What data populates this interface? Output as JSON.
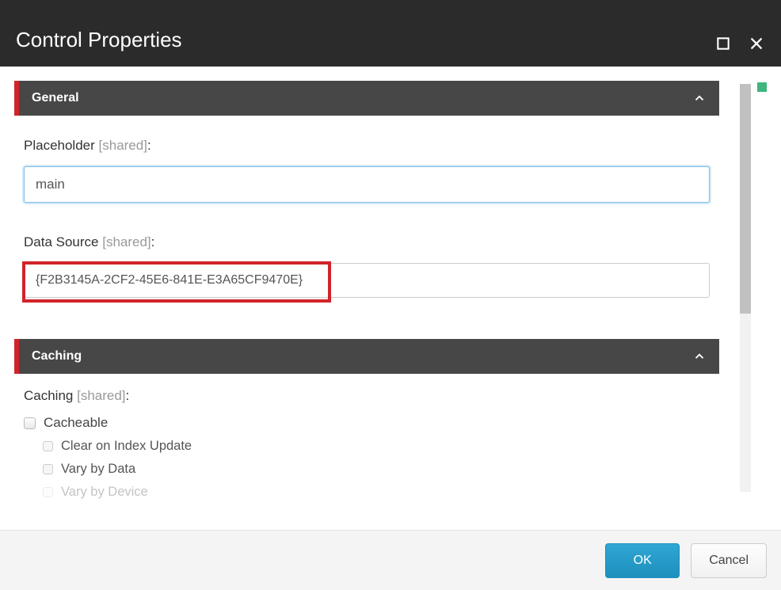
{
  "header": {
    "title": "Control Properties"
  },
  "sections": {
    "general": {
      "title": "General",
      "placeholder_label": "Placeholder",
      "shared_tag": "[shared]",
      "placeholder_value": "main",
      "datasource_label": "Data Source",
      "datasource_value": "{F2B3145A-2CF2-45E6-841E-E3A65CF9470E}"
    },
    "caching": {
      "title": "Caching",
      "caching_label": "Caching",
      "shared_tag": "[shared]",
      "options": {
        "cacheable": "Cacheable",
        "clear_index": "Clear on Index Update",
        "vary_data": "Vary by Data",
        "vary_device": "Vary by Device"
      }
    }
  },
  "footer": {
    "ok": "OK",
    "cancel": "Cancel"
  }
}
